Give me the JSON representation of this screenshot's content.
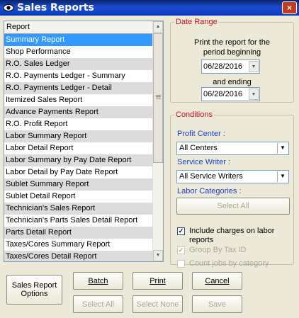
{
  "window": {
    "title": "Sales Reports",
    "close_glyph": "×"
  },
  "report_list": {
    "header": "Report",
    "selected_index": 0,
    "items": [
      "Summary Report",
      "Shop Performance",
      "R.O. Sales Ledger",
      "R.O. Payments Ledger - Summary",
      "R.O. Payments Ledger - Detail",
      "Itemized Sales Report",
      "Advance Payments Report",
      "R.O. Profit Report",
      "Labor Summary Report",
      "Labor Detail Report",
      "Labor Summary by Pay Date Report",
      "Labor Detail by Pay Date Report",
      "Sublet Summary Report",
      "Sublet Detail Report",
      "Technician's Sales Report",
      "Technician's Parts Sales Detail Report",
      "Parts Detail Report",
      "Taxes/Cores Summary Report",
      "Taxes/Cores Detail Report"
    ]
  },
  "date_range": {
    "legend": "Date Range",
    "begin_label_line1": "Print the report for the",
    "begin_label_line2": "period beginning",
    "begin_date": "06/28/2016",
    "end_label": "and ending",
    "end_date": "06/28/2016"
  },
  "conditions": {
    "legend": "Conditions",
    "profit_center_label": "Profit Center :",
    "profit_center_value": "All Centers",
    "service_writer_label": "Service Writer :",
    "service_writer_value": "All Service Writers",
    "labor_categories_label": "Labor Categories :",
    "select_all_label": "Select All",
    "include_charges_line1": "Include charges on labor",
    "include_charges_line2": "reports",
    "include_charges_checked": true,
    "group_by_tax_label": "Group By Tax ID",
    "group_by_tax_checked": true,
    "count_jobs_label": "Count jobs by category",
    "count_jobs_checked": false
  },
  "buttons": {
    "options_line1": "Sales Report",
    "options_line2": "Options",
    "batch": "Batch",
    "print": "Print",
    "cancel": "Cancel",
    "select_all": "Select All",
    "select_none": "Select None",
    "save": "Save"
  }
}
